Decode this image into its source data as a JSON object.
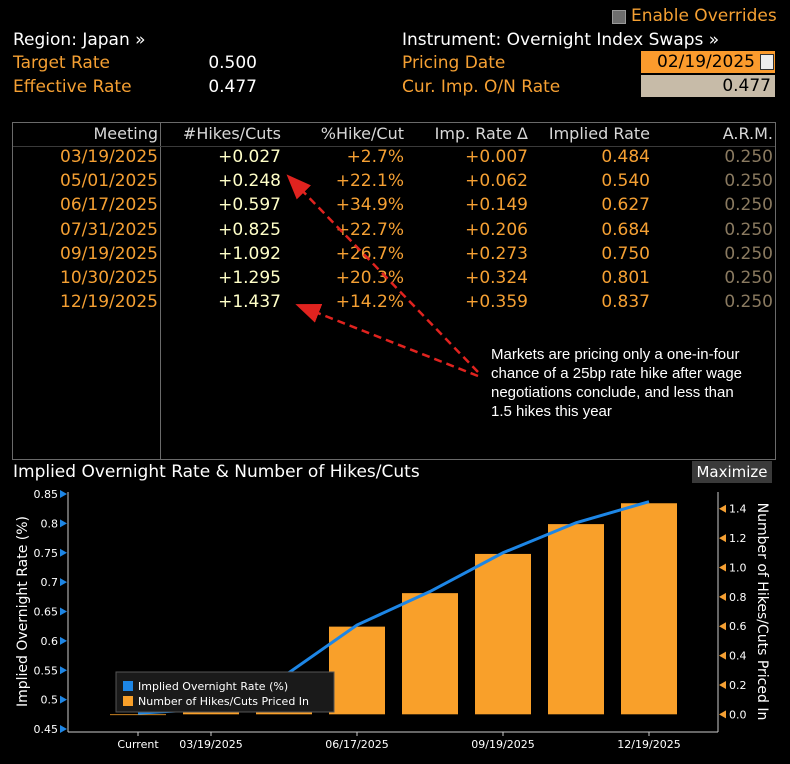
{
  "header": {
    "enable_overrides": "Enable Overrides",
    "region_label": "Region: Japan »",
    "instrument_label": "Instrument: Overnight Index Swaps »",
    "target_rate_label": "Target Rate",
    "target_rate_value": "0.500",
    "effective_rate_label": "Effective Rate",
    "effective_rate_value": "0.477",
    "pricing_date_label": "Pricing Date",
    "pricing_date_value": "02/19/2025",
    "cur_imp_label": "Cur. Imp. O/N Rate",
    "cur_imp_value": "0.477"
  },
  "table": {
    "columns": [
      "Meeting",
      "#Hikes/Cuts",
      "%Hike/Cut",
      "Imp. Rate Δ",
      "Implied Rate",
      "A.R.M."
    ],
    "rows": [
      {
        "meeting": "03/19/2025",
        "hikes": "+0.027",
        "pct": "+2.7%",
        "delta": "+0.007",
        "implied": "0.484",
        "arm": "0.250"
      },
      {
        "meeting": "05/01/2025",
        "hikes": "+0.248",
        "pct": "+22.1%",
        "delta": "+0.062",
        "implied": "0.540",
        "arm": "0.250"
      },
      {
        "meeting": "06/17/2025",
        "hikes": "+0.597",
        "pct": "+34.9%",
        "delta": "+0.149",
        "implied": "0.627",
        "arm": "0.250"
      },
      {
        "meeting": "07/31/2025",
        "hikes": "+0.825",
        "pct": "+22.7%",
        "delta": "+0.206",
        "implied": "0.684",
        "arm": "0.250"
      },
      {
        "meeting": "09/19/2025",
        "hikes": "+1.092",
        "pct": "+26.7%",
        "delta": "+0.273",
        "implied": "0.750",
        "arm": "0.250"
      },
      {
        "meeting": "10/30/2025",
        "hikes": "+1.295",
        "pct": "+20.3%",
        "delta": "+0.324",
        "implied": "0.801",
        "arm": "0.250"
      },
      {
        "meeting": "12/19/2025",
        "hikes": "+1.437",
        "pct": "+14.2%",
        "delta": "+0.359",
        "implied": "0.837",
        "arm": "0.250"
      }
    ],
    "annotation": "Markets are pricing only a one-in-four chance of a 25bp rate hike after wage negotiations conclude, and less than 1.5 hikes this year"
  },
  "chart_panel": {
    "title": "Implied Overnight Rate & Number of Hikes/Cuts",
    "maximize_label": "Maximize"
  },
  "colors": {
    "background": "#000000",
    "orange": "#f5a033",
    "bar": "#f9a02a",
    "line": "#1d86e6",
    "annotation_arrow": "#e0231f"
  },
  "chart_data": {
    "type": "bar",
    "ylabel": "Implied Overnight Rate (%)",
    "y2label": "Number of Hikes/Cuts Priced In",
    "ylim": [
      0.45,
      0.85
    ],
    "y2lim": [
      -0.1,
      1.5
    ],
    "yticks": [
      "0.85",
      "0.8",
      "0.75",
      "0.7",
      "0.65",
      "0.6",
      "0.55",
      "0.5",
      "0.45"
    ],
    "y2ticks": [
      "1.4",
      "1.2",
      "1.0",
      "0.8",
      "0.6",
      "0.4",
      "0.2",
      "0.0"
    ],
    "xtick_labels": [
      "Current",
      "03/19/2025",
      "06/17/2025",
      "09/19/2025",
      "12/19/2025"
    ],
    "categories": [
      "Current",
      "03/19/2025",
      "05/01/2025",
      "06/17/2025",
      "07/31/2025",
      "09/19/2025",
      "10/30/2025",
      "12/19/2025"
    ],
    "series": [
      {
        "name": "Implied Overnight Rate (%)",
        "type": "line",
        "axis": "left",
        "values": [
          0.477,
          0.484,
          0.54,
          0.627,
          0.684,
          0.75,
          0.801,
          0.837
        ]
      },
      {
        "name": "Number of Hikes/Cuts Priced In",
        "type": "bar",
        "axis": "right",
        "values": [
          0.0,
          0.027,
          0.248,
          0.597,
          0.825,
          1.092,
          1.295,
          1.437
        ]
      }
    ],
    "legend_position": "bottom-left"
  }
}
